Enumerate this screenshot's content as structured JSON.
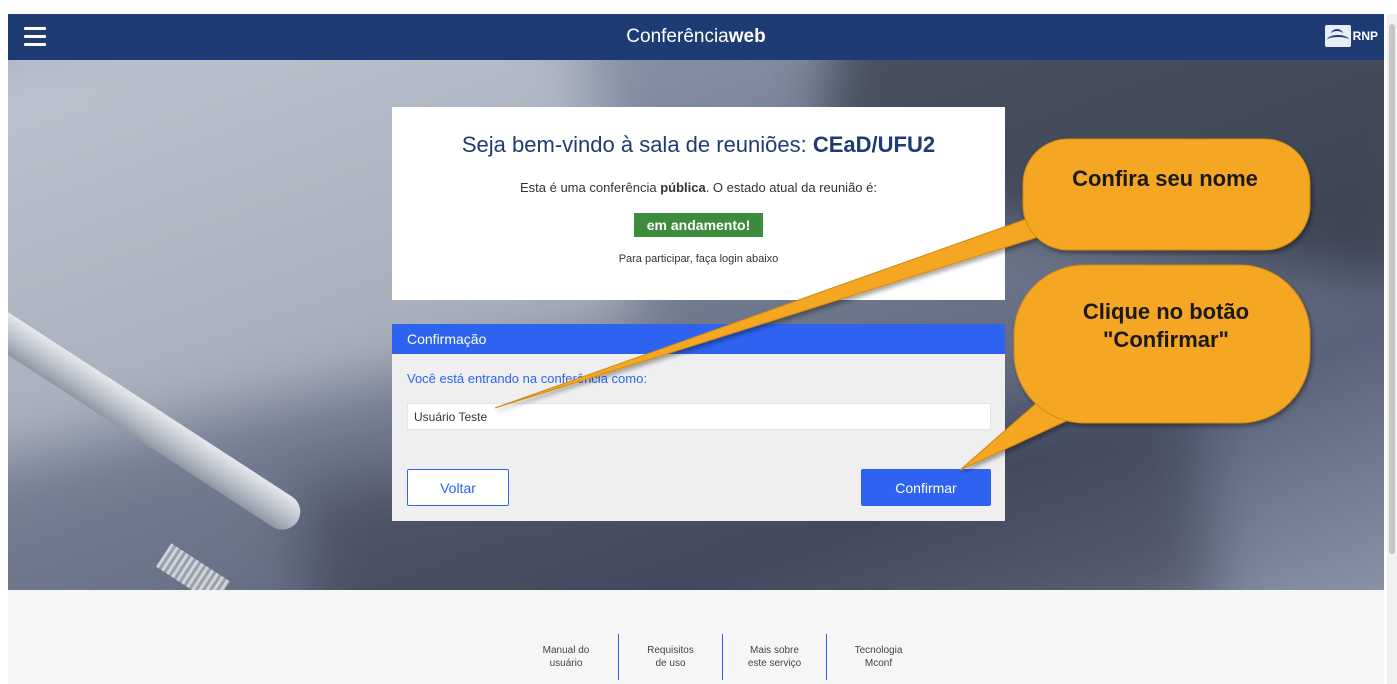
{
  "header": {
    "brand_thin": "Conferência",
    "brand_bold": "web",
    "rnp_label": "RNP"
  },
  "welcome": {
    "title_prefix": "Seja bem-vindo à sala de reuniões: ",
    "room_name": "CEaD/UFU2",
    "desc_prefix": "Esta é uma conferência ",
    "desc_bold": "pública",
    "desc_suffix": ". O estado atual da reunião é:",
    "status": "em andamento!",
    "hint": "Para participar, faça login abaixo"
  },
  "confirm": {
    "header": "Confirmação",
    "prompt": "Você está entrando na conferência como:",
    "name_value": "Usuário Teste",
    "back_label": "Voltar",
    "confirm_label": "Confirmar"
  },
  "callouts": {
    "check_name": "Confira seu nome",
    "click_button": "Clique no botão \"Confirmar\""
  },
  "footer": {
    "links": [
      {
        "line1": "Manual do",
        "line2": "usuário"
      },
      {
        "line1": "Requisitos",
        "line2": "de uso"
      },
      {
        "line1": "Mais sobre",
        "line2": "este serviço"
      },
      {
        "line1": "Tecnologia",
        "line2": "Mconf"
      }
    ]
  },
  "colors": {
    "navbar": "#1f3b73",
    "accent_blue": "#2e63f2",
    "status_green": "#3d8b3d",
    "callout_orange": "#f5a623"
  },
  "icons": {
    "menu": "hamburger-menu-icon",
    "logo": "rnp-logo-icon"
  }
}
